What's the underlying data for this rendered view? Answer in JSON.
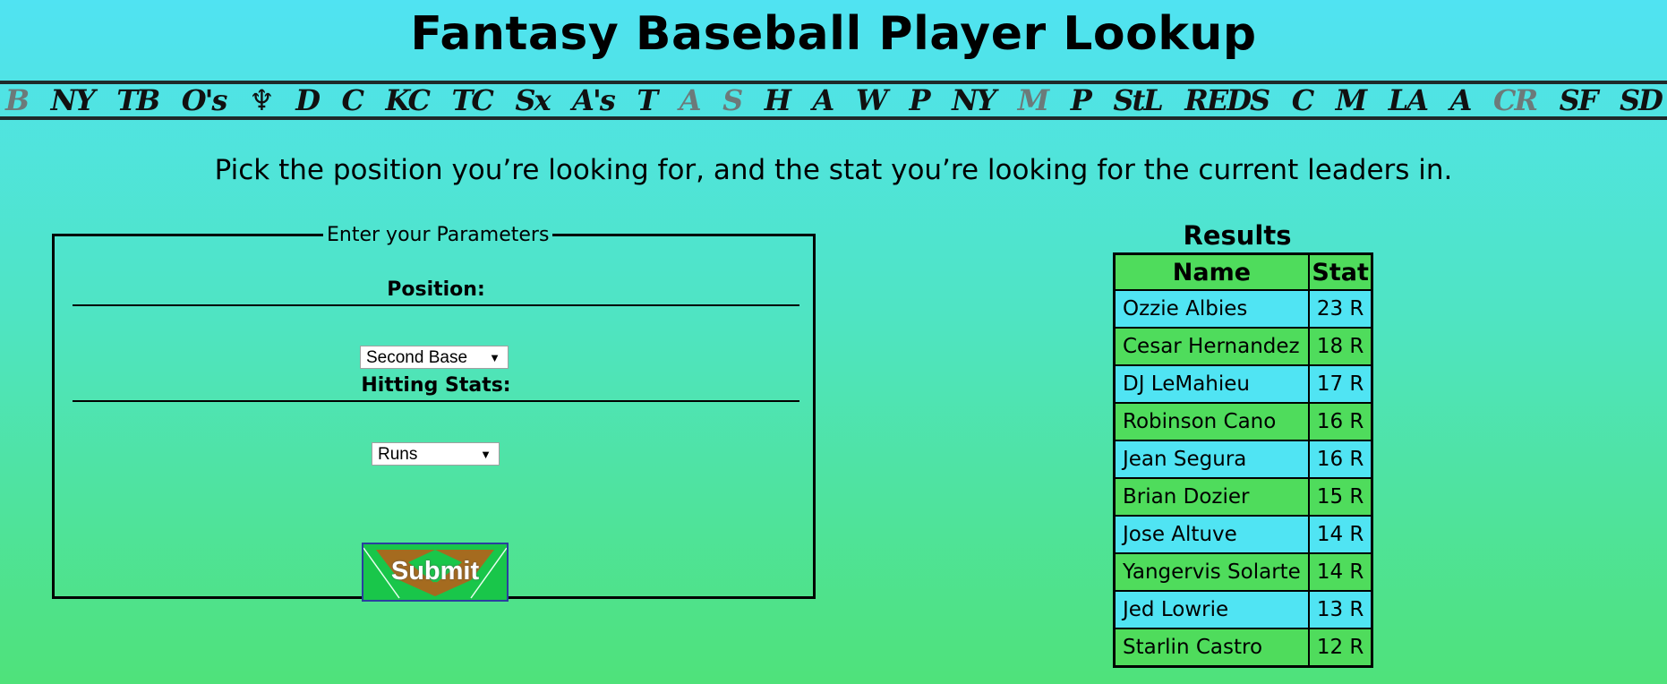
{
  "header": {
    "title": "Fantasy Baseball Player Lookup"
  },
  "team_logos": [
    {
      "glyph": "B",
      "icon": "red-sox-logo-icon",
      "light": true
    },
    {
      "glyph": "NY",
      "icon": "yankees-logo-icon"
    },
    {
      "glyph": "TB",
      "icon": "rays-logo-icon"
    },
    {
      "glyph": "O's",
      "icon": "orioles-logo-icon"
    },
    {
      "glyph": "♆",
      "icon": "blue-jays-logo-icon"
    },
    {
      "glyph": "D",
      "icon": "tigers-logo-icon"
    },
    {
      "glyph": "C",
      "icon": "indians-logo-icon"
    },
    {
      "glyph": "KC",
      "icon": "royals-logo-icon"
    },
    {
      "glyph": "TC",
      "icon": "twins-logo-icon"
    },
    {
      "glyph": "Sx",
      "icon": "white-sox-logo-icon"
    },
    {
      "glyph": "A's",
      "icon": "athletics-logo-icon"
    },
    {
      "glyph": "T",
      "icon": "rangers-logo-icon"
    },
    {
      "glyph": "A",
      "icon": "angels-logo-icon",
      "light": true
    },
    {
      "glyph": "S",
      "icon": "mariners-logo-icon",
      "light": true
    },
    {
      "glyph": "H",
      "icon": "astros-logo-icon"
    },
    {
      "glyph": "A",
      "icon": "braves-logo-icon"
    },
    {
      "glyph": "W",
      "icon": "nationals-logo-icon"
    },
    {
      "glyph": "P",
      "icon": "phillies-logo-icon"
    },
    {
      "glyph": "NY",
      "icon": "mets-logo-icon"
    },
    {
      "glyph": "M",
      "icon": "marlins-logo-icon",
      "light": true
    },
    {
      "glyph": "P",
      "icon": "pirates-logo-icon"
    },
    {
      "glyph": "StL",
      "icon": "cardinals-logo-icon"
    },
    {
      "glyph": "REDS",
      "icon": "reds-logo-icon"
    },
    {
      "glyph": "C",
      "icon": "cubs-logo-icon"
    },
    {
      "glyph": "M",
      "icon": "brewers-logo-icon"
    },
    {
      "glyph": "LA",
      "icon": "dodgers-logo-icon"
    },
    {
      "glyph": "A",
      "icon": "diamondbacks-logo-icon"
    },
    {
      "glyph": "CR",
      "icon": "rockies-logo-icon",
      "light": true
    },
    {
      "glyph": "SF",
      "icon": "giants-logo-icon"
    },
    {
      "glyph": "SD",
      "icon": "padres-logo-icon"
    }
  ],
  "instructions": "Pick the position you’re looking for, and the stat you’re looking for the current leaders in.",
  "form": {
    "legend": "Enter your Parameters",
    "position_label": "Position:",
    "position_value": "Second Base",
    "stats_label": "Hitting Stats:",
    "stats_value": "Runs",
    "submit_label": "Submit"
  },
  "results": {
    "title": "Results",
    "columns": [
      "Name",
      "Stat"
    ],
    "rows": [
      {
        "name": "Ozzie Albies",
        "stat": "23 R"
      },
      {
        "name": "Cesar Hernandez",
        "stat": "18 R"
      },
      {
        "name": "DJ LeMahieu",
        "stat": "17 R"
      },
      {
        "name": "Robinson Cano",
        "stat": "16 R"
      },
      {
        "name": "Jean Segura",
        "stat": "16 R"
      },
      {
        "name": "Brian Dozier",
        "stat": "15 R"
      },
      {
        "name": "Jose Altuve",
        "stat": "14 R"
      },
      {
        "name": "Yangervis Solarte",
        "stat": "14 R"
      },
      {
        "name": "Jed Lowrie",
        "stat": "13 R"
      },
      {
        "name": "Starlin Castro",
        "stat": "12 R"
      }
    ]
  },
  "colors": {
    "row_blue": "#50e4f3",
    "row_green": "#4fdc5c",
    "submit_green": "#19c64a",
    "infield_dirt": "#a56b1f"
  }
}
